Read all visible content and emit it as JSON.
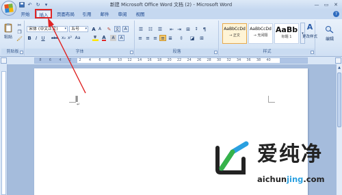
{
  "window": {
    "title": "新建 Microsoft Office Word 文档 (2) - Microsoft Word"
  },
  "quick_access": [
    "save-icon",
    "undo-icon",
    "redo-icon",
    "customize-icon"
  ],
  "tabs": [
    {
      "label": "开始",
      "active": false
    },
    {
      "label": "插入",
      "active": true
    },
    {
      "label": "页面布局",
      "active": false
    },
    {
      "label": "引用",
      "active": false
    },
    {
      "label": "邮件",
      "active": false
    },
    {
      "label": "审阅",
      "active": false
    },
    {
      "label": "视图",
      "active": false
    }
  ],
  "ribbon": {
    "clipboard": {
      "label": "剪贴板",
      "paste_label": "粘贴"
    },
    "font": {
      "label": "字体",
      "font_name": "宋体 (中文正文)",
      "font_size": "五号",
      "btn_bold": "B",
      "btn_italic": "I",
      "btn_underline": "U",
      "btn_grow": "A",
      "btn_shrink": "A",
      "btn_wen": "文",
      "btn_abc": "abc",
      "btn_color_a": "A",
      "btn_aa": "Aa"
    },
    "paragraph": {
      "label": "段落"
    },
    "styles": {
      "label": "样式",
      "items": [
        {
          "sample": "AaBbCcDd",
          "name": "→ 正文",
          "selected": true
        },
        {
          "sample": "AaBbCcDd",
          "name": "→ 无间隔",
          "selected": false
        },
        {
          "sample": "AaBb",
          "name": "标题 1",
          "selected": false
        }
      ],
      "change_styles_label": "更改样式"
    },
    "editing": {
      "label": "编辑"
    }
  },
  "ruler": {
    "numbers": [
      "8",
      "6",
      "4",
      "2",
      "2",
      "4",
      "6",
      "8",
      "10",
      "12",
      "14",
      "16",
      "18",
      "20",
      "22",
      "24",
      "26",
      "28",
      "30",
      "32",
      "34",
      "36",
      "38",
      "40"
    ]
  },
  "document": {
    "para_mark": "↵"
  },
  "watermark": {
    "title": "爱纯净",
    "url": "aichunjing.com",
    "url_highlight": "jing"
  },
  "colors": {
    "annotation": "#e02525",
    "ribbon_bg": "#dbe8f7",
    "tab_text": "#15428b"
  }
}
